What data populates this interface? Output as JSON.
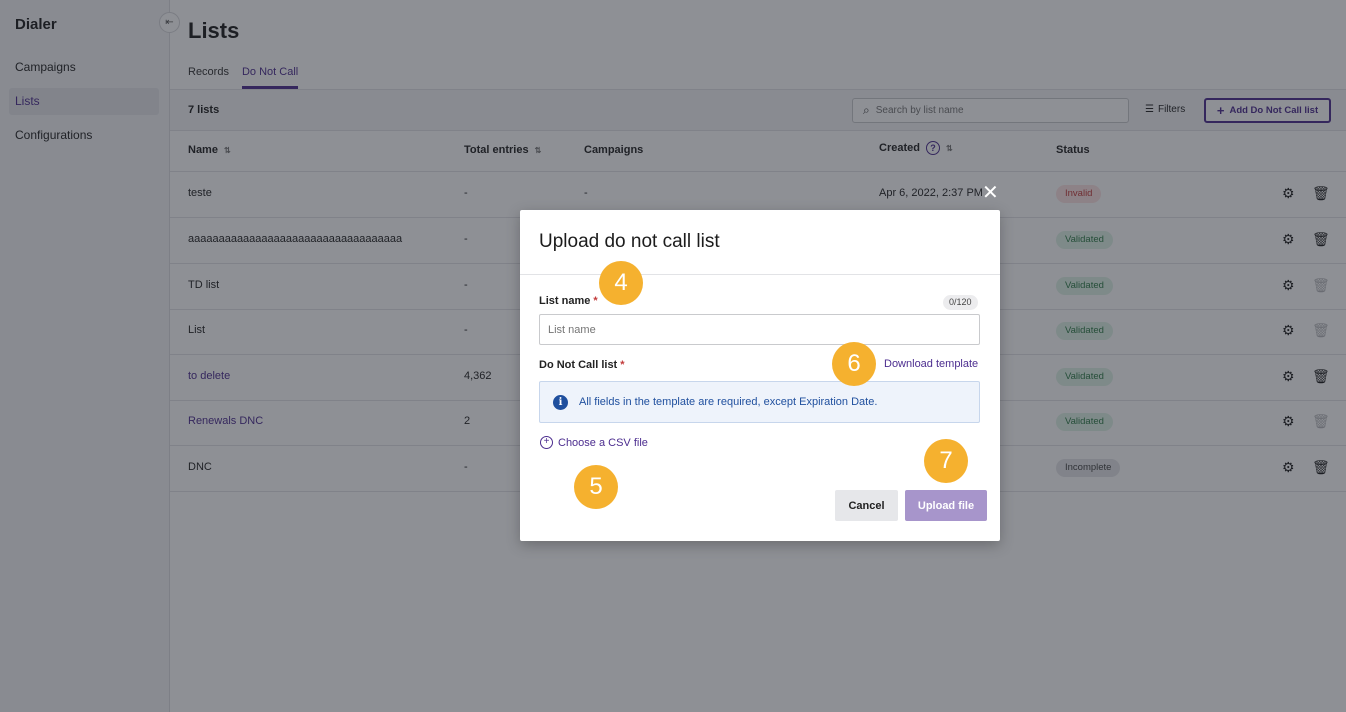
{
  "app": {
    "title": "Dialer",
    "collapse_icon": "⇤"
  },
  "sidebar": {
    "items": [
      {
        "label": "Campaigns",
        "active": false
      },
      {
        "label": "Lists",
        "active": true
      },
      {
        "label": "Configurations",
        "active": false
      }
    ]
  },
  "page": {
    "title": "Lists",
    "tabs": [
      {
        "label": "Records",
        "active": false
      },
      {
        "label": "Do Not Call",
        "active": true
      }
    ]
  },
  "toolbar": {
    "count": "7 lists",
    "search_placeholder": "Search by list name",
    "filters_label": "Filters",
    "add_label": "Add Do Not Call list"
  },
  "table": {
    "headers": {
      "name": "Name",
      "total": "Total entries",
      "campaigns": "Campaigns",
      "created": "Created",
      "status": "Status"
    },
    "rows": [
      {
        "name": "teste",
        "total": "-",
        "campaigns": "-",
        "created": "Apr 6, 2022, 2:37 PM",
        "status": "Invalid",
        "status_kind": "invalid",
        "link": false,
        "delete_enabled": true
      },
      {
        "name": "aaaaaaaaaaaaaaaaaaaaaaaaaaaaaaaaaaa",
        "total": "-",
        "campaigns": "",
        "created": "",
        "status": "Validated",
        "status_kind": "validated",
        "link": false,
        "delete_enabled": true
      },
      {
        "name": "TD list",
        "total": "-",
        "campaigns": "",
        "created": "",
        "status": "Validated",
        "status_kind": "validated",
        "link": false,
        "delete_enabled": false
      },
      {
        "name": "List",
        "total": "-",
        "campaigns": "",
        "created": "",
        "status": "Validated",
        "status_kind": "validated",
        "link": false,
        "delete_enabled": false
      },
      {
        "name": "to delete",
        "total": "4,362",
        "campaigns": "",
        "created": "",
        "status": "Validated",
        "status_kind": "validated",
        "link": true,
        "delete_enabled": true
      },
      {
        "name": "Renewals DNC",
        "total": "2",
        "campaigns": "",
        "created": "",
        "status": "Validated",
        "status_kind": "validated",
        "link": true,
        "delete_enabled": false
      },
      {
        "name": "DNC",
        "total": "-",
        "campaigns": "",
        "created": "",
        "status": "Incomplete",
        "status_kind": "incomplete",
        "link": false,
        "delete_enabled": true
      }
    ]
  },
  "modal": {
    "title": "Upload do not call list",
    "list_name_label": "List name",
    "required_mark": "*",
    "counter": "0/120",
    "list_name_placeholder": "List name",
    "list_name_value": "",
    "dnc_label": "Do Not Call list",
    "download_template": "Download template",
    "info_text": "All fields in the template are required, except Expiration Date.",
    "choose_csv": "Choose a CSV file",
    "cancel": "Cancel",
    "upload": "Upload file"
  },
  "steps": [
    "4",
    "5",
    "6",
    "7"
  ],
  "colors": {
    "brand": "#4c2d8f",
    "step": "#f5b12f",
    "invalid": "#c23a3a",
    "validated": "#2c7a47",
    "info": "#1f4f9e"
  },
  "icons": {
    "close": "✕",
    "search": "⌕",
    "filters": "☰",
    "plus": "+",
    "sort": "⇅",
    "help": "?",
    "gear": "⚙",
    "trash": "🗑",
    "info": "i"
  }
}
